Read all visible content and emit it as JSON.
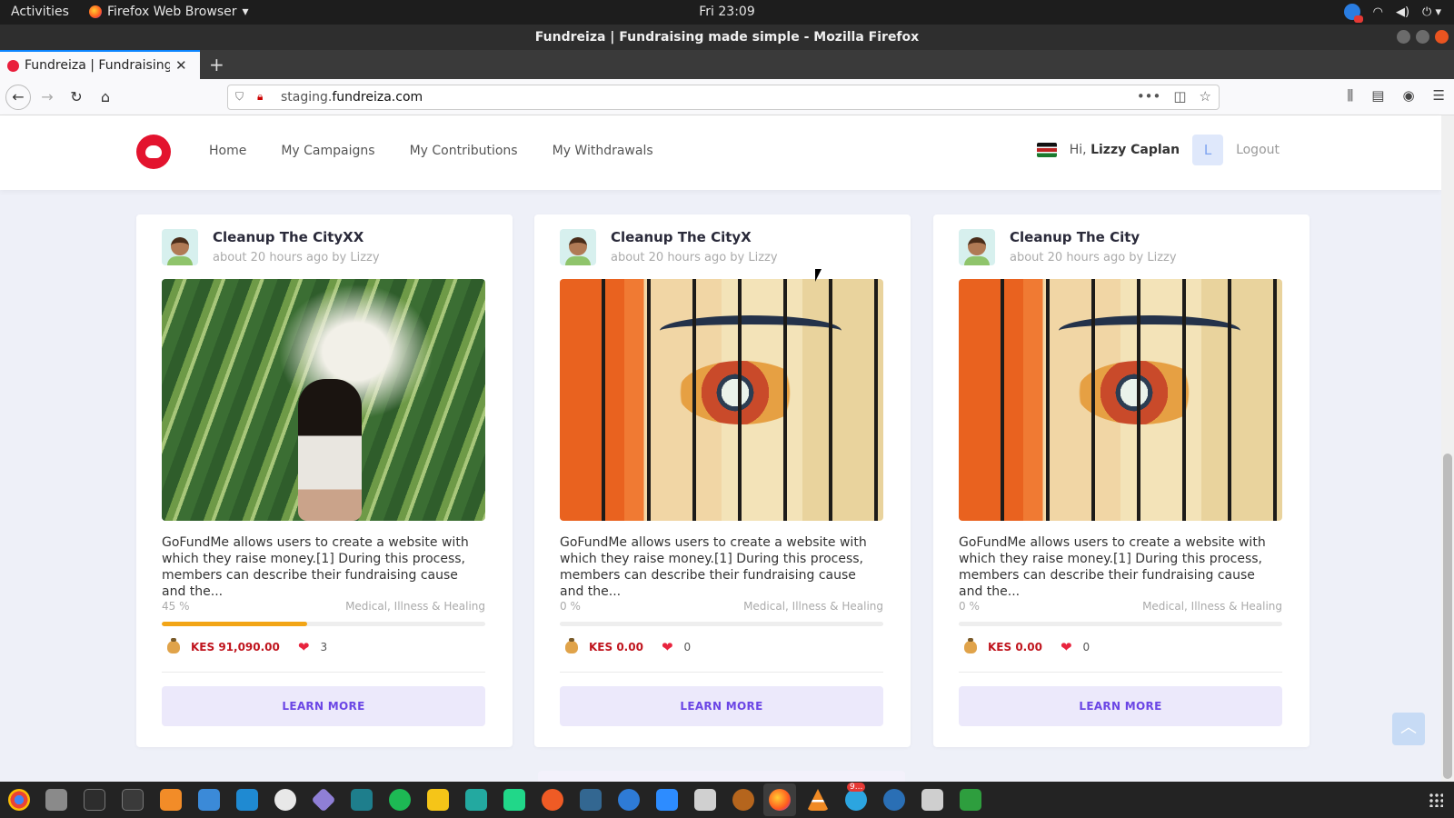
{
  "system": {
    "activities": "Activities",
    "app_name": "Firefox Web Browser",
    "clock": "Fri 23:09",
    "tray_icons": [
      "updates-icon",
      "wifi-icon",
      "volume-icon",
      "power-icon"
    ]
  },
  "window": {
    "title": "Fundreiza | Fundraising made simple - Mozilla Firefox"
  },
  "browser": {
    "tab_title": "Fundreiza | Fundraising made simple",
    "url_host_prefix": "staging.",
    "url_host_domain": "fundreiza.com"
  },
  "site": {
    "nav": [
      "Home",
      "My Campaigns",
      "My Contributions",
      "My Withdrawals"
    ],
    "greeting_prefix": "Hi,",
    "user_name": "Lizzy Caplan",
    "user_initial": "L",
    "logout": "Logout"
  },
  "campaigns": [
    {
      "title": "Cleanup The CityXX",
      "subtitle": "about 20 hours ago by Lizzy",
      "description": "GoFundMe allows users to create a website with which they raise money.[1] During this process, members can describe their fundraising cause and the...",
      "percent_label": "45 %",
      "progress": 0.45,
      "category": "Medical, Illness & Healing",
      "amount": "KES 91,090.00",
      "likes": "3",
      "button": "LEARN MORE",
      "image": "cornfield-photo"
    },
    {
      "title": "Cleanup The CityX",
      "subtitle": "about 20 hours ago by Lizzy",
      "description": "GoFundMe allows users to create a website with which they raise money.[1] During this process, members can describe their fundraising cause and the...",
      "percent_label": "0 %",
      "progress": 0,
      "category": "Medical, Illness & Healing",
      "amount": "KES 0.00",
      "likes": "0",
      "button": "LEARN MORE",
      "image": "mural-eye-photo"
    },
    {
      "title": "Cleanup The City",
      "subtitle": "about 20 hours ago by Lizzy",
      "description": "GoFundMe allows users to create a website with which they raise money.[1] During this process, members can describe their fundraising cause and the...",
      "percent_label": "0 %",
      "progress": 0,
      "category": "Medical, Illness & Healing",
      "amount": "KES 0.00",
      "likes": "0",
      "button": "LEARN MORE",
      "image": "mural-eye-photo"
    }
  ],
  "dock_badge": "9...",
  "colors": {
    "brand_red": "#e3132e",
    "progress_orange": "#f2a516",
    "button_bg": "#ece9fb",
    "button_text": "#6b46e5",
    "amount_red": "#c0151e"
  }
}
